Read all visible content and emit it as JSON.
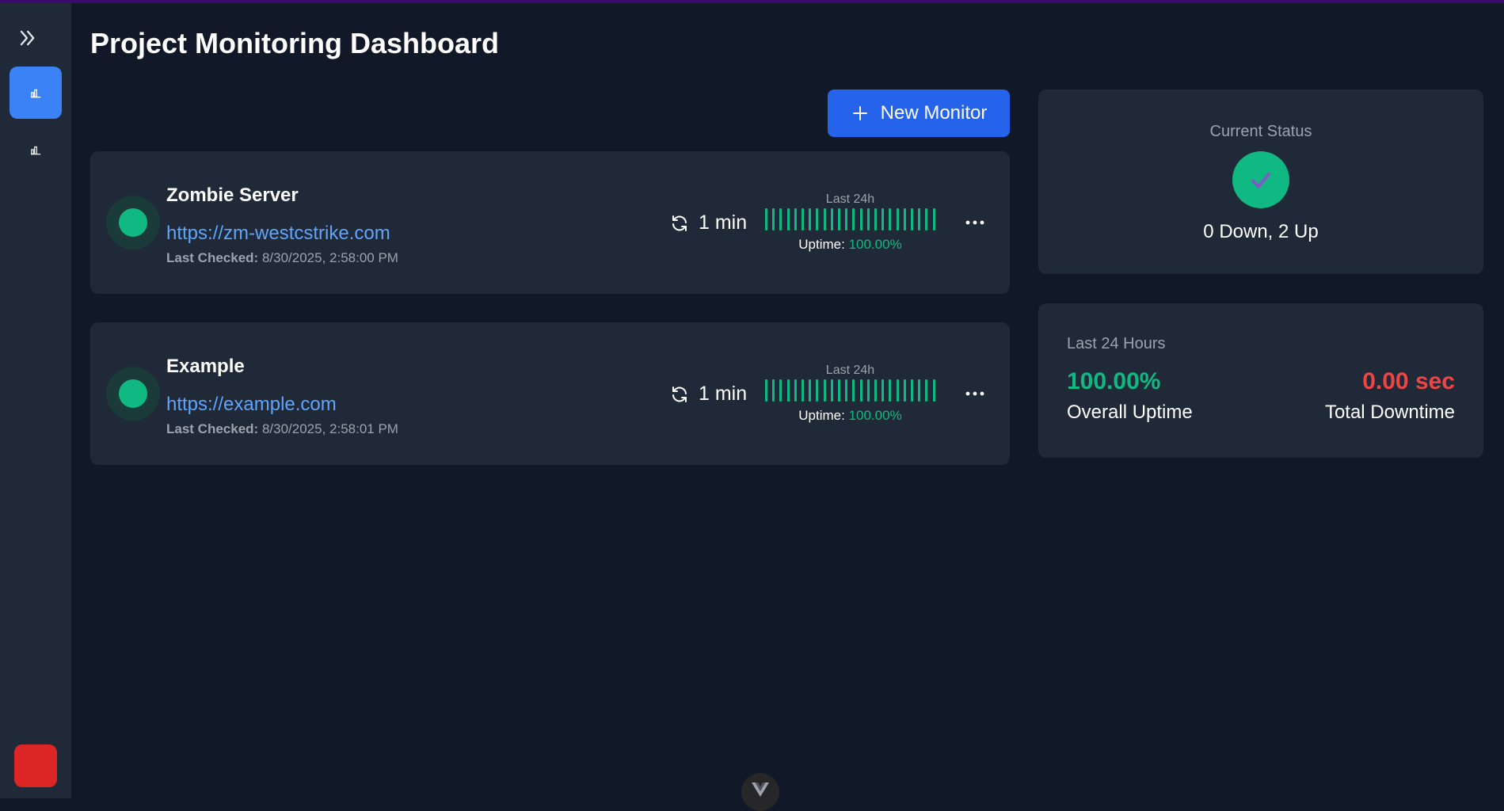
{
  "page": {
    "title": "Project Monitoring Dashboard"
  },
  "sidebar": {
    "toggle_icon": "double-chevron-right-icon",
    "items": [
      {
        "icon": "bar-chart-icon",
        "active": true
      },
      {
        "icon": "bar-chart-icon",
        "active": false
      }
    ],
    "bottom_color": "#dc2626"
  },
  "toolbar": {
    "new_monitor_label": "New Monitor",
    "new_monitor_icon": "plus-icon"
  },
  "monitors": [
    {
      "name": "Zombie Server",
      "url": "https://zm-westcstrike.com",
      "last_checked_label": "Last Checked:",
      "last_checked": "8/30/2025, 2:58:00 PM",
      "interval": "1 min",
      "history_label": "Last 24h",
      "uptime_label": "Uptime:",
      "uptime": "100.00%",
      "status": "up"
    },
    {
      "name": "Example",
      "url": "https://example.com",
      "last_checked_label": "Last Checked:",
      "last_checked": "8/30/2025, 2:58:01 PM",
      "interval": "1 min",
      "history_label": "Last 24h",
      "uptime_label": "Uptime:",
      "uptime": "100.00%",
      "status": "up"
    }
  ],
  "current_status": {
    "label": "Current Status",
    "summary": "0 Down, 2 Up",
    "icon": "check-icon"
  },
  "last_24_hours": {
    "title": "Last 24 Hours",
    "overall_uptime_value": "100.00%",
    "overall_uptime_label": "Overall Uptime",
    "total_downtime_value": "0.00 sec",
    "total_downtime_label": "Total Downtime"
  },
  "colors": {
    "accent": "#2563eb",
    "up": "#10b981",
    "down": "#ef4444",
    "link": "#60a5fa"
  }
}
